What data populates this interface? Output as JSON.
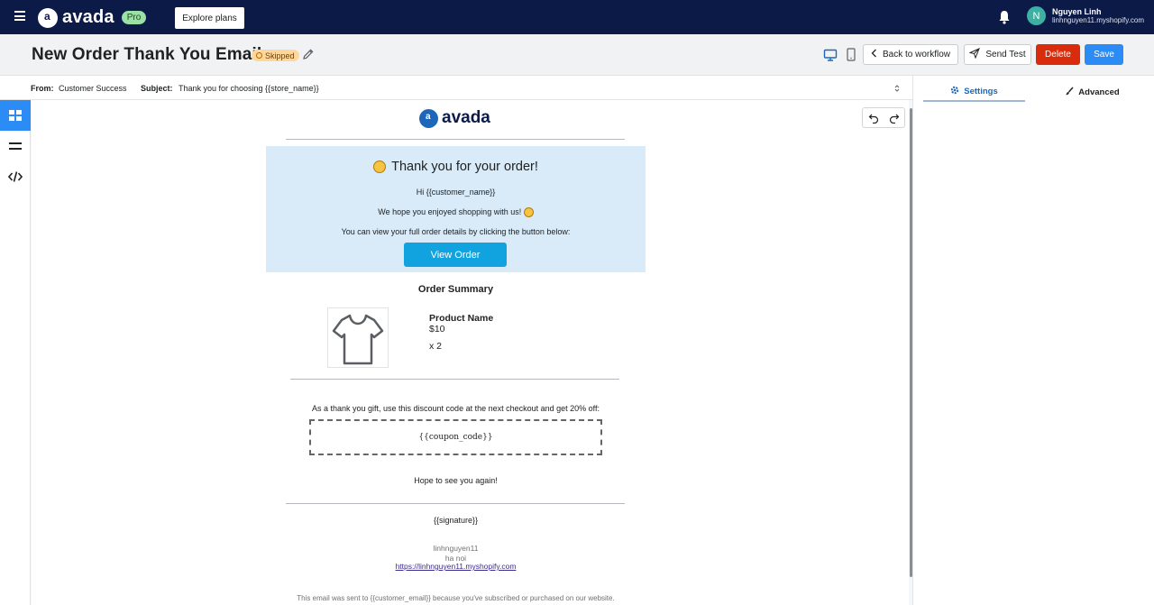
{
  "topbar": {
    "brand": "avada",
    "plan_badge": "Pro",
    "explore_label": "Explore plans",
    "user_initial": "N",
    "user_name": "Nguyen Linh",
    "user_shop": "linhnguyen11.myshopify.com"
  },
  "header": {
    "title": "New Order Thank You Email",
    "status": "Skipped",
    "back_label": "Back to workflow",
    "send_test_label": "Send Test",
    "delete_label": "Delete",
    "save_label": "Save"
  },
  "subject_row": {
    "from_label": "From:",
    "from_value": "Customer Success",
    "subject_label": "Subject:",
    "subject_value": "Thank you for choosing {{store_name}}"
  },
  "icons": {
    "menu": "hamburger-icon",
    "bell": "bell-icon",
    "pencil": "pencil-icon",
    "desktop": "desktop-icon",
    "mobile": "mobile-icon",
    "back": "chevron-left-icon",
    "send": "send-icon",
    "undo": "undo-icon",
    "redo": "redo-icon",
    "blocks": "blocks-icon",
    "rows": "rows-icon",
    "code": "code-icon",
    "gear": "gear-icon",
    "brush": "brush-icon"
  },
  "email": {
    "logo_text": "avada",
    "heading": "Thank you for your order!",
    "greeting": "Hi {{customer_name}}",
    "hope_line": "We hope you enjoyed shopping with us!",
    "view_details": "You can view your full order details by clicking the button below:",
    "view_order_label": "View Order",
    "order_summary": "Order Summary",
    "product_name": "Product Name",
    "product_price": "$10",
    "product_qty": "x 2",
    "gift_text": "As a thank you gift, use this discount code at the next checkout and get 20% off:",
    "coupon": "{{coupon_code}}",
    "hope_see": "Hope to see you again!",
    "signature": "{{signature}}",
    "shop_name": "linhnguyen11",
    "shop_city": "ha noi",
    "shop_url": "https://linhnguyen11.myshopify.com",
    "footer": "This email was sent to {{customer_email}} because you've subscribed or purchased on our website."
  },
  "right_panel": {
    "tab_settings": "Settings",
    "tab_advanced": "Advanced"
  },
  "colors": {
    "topbar": "#0c1a47",
    "primary": "#2c8cf5",
    "danger": "#d82c0d",
    "email_banner": "#d9ebf9",
    "cta": "#11a3e0"
  }
}
